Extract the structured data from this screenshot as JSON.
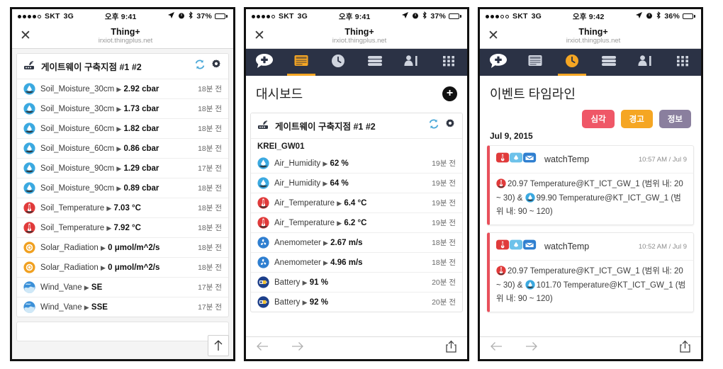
{
  "panels": [
    {
      "status": {
        "carrier": "SKT",
        "network": "3G",
        "time": "오후 9:41",
        "battery_pct": "37%",
        "dots_filled": 4,
        "dots_total": 5
      },
      "browser": {
        "title": "Thing+",
        "url": "irxiot.thingplus.net",
        "close_label": "✕"
      },
      "gateway": {
        "name": "게이트웨이 구축지점 #1 #2"
      },
      "rows": [
        {
          "icon": "water-drop-icon",
          "name": "Soil_Moisture_30cm",
          "value": "2.92 cbar",
          "ago": "18분 전"
        },
        {
          "icon": "water-drop-icon",
          "name": "Soil_Moisture_30cm",
          "value": "1.73 cbar",
          "ago": "18분 전"
        },
        {
          "icon": "water-drop-icon",
          "name": "Soil_Moisture_60cm",
          "value": "1.82 cbar",
          "ago": "18분 전"
        },
        {
          "icon": "water-drop-icon",
          "name": "Soil_Moisture_60cm",
          "value": "0.86 cbar",
          "ago": "18분 전"
        },
        {
          "icon": "water-drop-icon",
          "name": "Soil_Moisture_90cm",
          "value": "1.29 cbar",
          "ago": "17분 전"
        },
        {
          "icon": "water-drop-icon",
          "name": "Soil_Moisture_90cm",
          "value": "0.89 cbar",
          "ago": "18분 전"
        },
        {
          "icon": "thermometer-icon",
          "name": "Soil_Temperature",
          "value": "7.03 °C",
          "ago": "18분 전"
        },
        {
          "icon": "thermometer-icon",
          "name": "Soil_Temperature",
          "value": "7.92 °C",
          "ago": "18분 전"
        },
        {
          "icon": "sun-ring-icon",
          "name": "Solar_Radiation",
          "value": "0 μmol/m^2/s",
          "ago": "18분 전"
        },
        {
          "icon": "sun-ring-icon",
          "name": "Solar_Radiation",
          "value": "0 μmol/m^2/s",
          "ago": "18분 전"
        },
        {
          "icon": "wind-globe-icon",
          "name": "Wind_Vane",
          "value": "SE",
          "ago": "17분 전"
        },
        {
          "icon": "wind-globe-icon",
          "name": "Wind_Vane",
          "value": "SSE",
          "ago": "17분 전"
        }
      ],
      "scroll_top_label": "↑"
    },
    {
      "status": {
        "carrier": "SKT",
        "network": "3G",
        "time": "오후 9:41",
        "battery_pct": "37%",
        "dots_filled": 4,
        "dots_total": 5
      },
      "browser": {
        "title": "Thing+",
        "url": "irxiot.thingplus.net",
        "close_label": "✕"
      },
      "tabs": [
        {
          "name": "add-tab",
          "icon": "plus-badge-icon",
          "active": false
        },
        {
          "name": "dashboard-tab",
          "icon": "dashboard-icon",
          "active": true
        },
        {
          "name": "timeline-tab",
          "icon": "clock-icon",
          "active": false
        },
        {
          "name": "layers-tab",
          "icon": "layers-icon",
          "active": false
        },
        {
          "name": "analytics-tab",
          "icon": "person-chart-icon",
          "active": false
        },
        {
          "name": "grid-tab",
          "icon": "grid-icon",
          "active": false
        }
      ],
      "page_title": "대시보드",
      "gateway": {
        "name": "게이트웨이 구축지점 #1 #2",
        "sub": "KREI_GW01"
      },
      "rows": [
        {
          "icon": "water-drop-icon",
          "name": "Air_Humidity",
          "value": "62 %",
          "ago": "19분 전"
        },
        {
          "icon": "water-drop-icon",
          "name": "Air_Humidity",
          "value": "64 %",
          "ago": "19분 전"
        },
        {
          "icon": "thermometer-icon",
          "name": "Air_Temperature",
          "value": "6.4 °C",
          "ago": "19분 전"
        },
        {
          "icon": "thermometer-icon",
          "name": "Air_Temperature",
          "value": "6.2 °C",
          "ago": "19분 전"
        },
        {
          "icon": "anemometer-icon",
          "name": "Anemometer",
          "value": "2.67 m/s",
          "ago": "18분 전"
        },
        {
          "icon": "anemometer-icon",
          "name": "Anemometer",
          "value": "4.96 m/s",
          "ago": "18분 전"
        },
        {
          "icon": "battery-icon",
          "name": "Battery",
          "value": "91 %",
          "ago": "20분 전"
        },
        {
          "icon": "battery-icon",
          "name": "Battery",
          "value": "92 %",
          "ago": "20분 전"
        }
      ],
      "bottombar": {
        "back": "←",
        "forward": "→",
        "share": "share-icon"
      }
    },
    {
      "status": {
        "carrier": "SKT",
        "network": "3G",
        "time": "오후 9:42",
        "battery_pct": "36%",
        "dots_filled": 3,
        "dots_total": 5
      },
      "browser": {
        "title": "Thing+",
        "url": "irxiot.thingplus.net",
        "close_label": "✕"
      },
      "tabs": [
        {
          "name": "add-tab",
          "icon": "plus-badge-icon",
          "active": false
        },
        {
          "name": "dashboard-tab",
          "icon": "dashboard-icon",
          "active": false
        },
        {
          "name": "timeline-tab",
          "icon": "clock-icon",
          "active": true
        },
        {
          "name": "layers-tab",
          "icon": "layers-icon",
          "active": false
        },
        {
          "name": "analytics-tab",
          "icon": "person-chart-icon",
          "active": false
        },
        {
          "name": "grid-tab",
          "icon": "grid-icon",
          "active": false
        }
      ],
      "page_title": "이벤트 타임라인",
      "chips": [
        {
          "label": "심각",
          "color": "#ef5767"
        },
        {
          "label": "경고",
          "color": "#f5a623"
        },
        {
          "label": "정보",
          "color": "#8a7f9e"
        }
      ],
      "event_date": "Jul 9, 2015",
      "events": [
        {
          "name": "watchTemp",
          "time": "10:57 AM / Jul 9",
          "text": "20.97 Temperature@KT_ICT_GW_1 (범위 내: 20 ~ 30) & 99.90 Temperature@KT_ICT_GW_1 (범위 내: 90 ~ 120)",
          "value_a": "20.97",
          "value_b": "99.90",
          "severity_color": "#e8505b"
        },
        {
          "name": "watchTemp",
          "time": "10:52 AM / Jul 9",
          "text": "20.97 Temperature@KT_ICT_GW_1 (범위 내: 20 ~ 30) & 101.70 Temperature@KT_ICT_GW_1 (범위 내: 90 ~ 120)",
          "value_a": "20.97",
          "value_b": "101.70",
          "severity_color": "#e8505b"
        }
      ],
      "bottombar": {
        "back": "←",
        "forward": "→",
        "share": "share-icon"
      }
    }
  ],
  "colors": {
    "tabbar_bg": "#2b3245",
    "tab_active": "#f5a623",
    "drop_blue": "#3ba9e0",
    "thermo_red": "#e03b3b",
    "solar_orange": "#f0a020",
    "wind_blue": "#3b90d8",
    "battery_navy": "#1d3f8a"
  }
}
